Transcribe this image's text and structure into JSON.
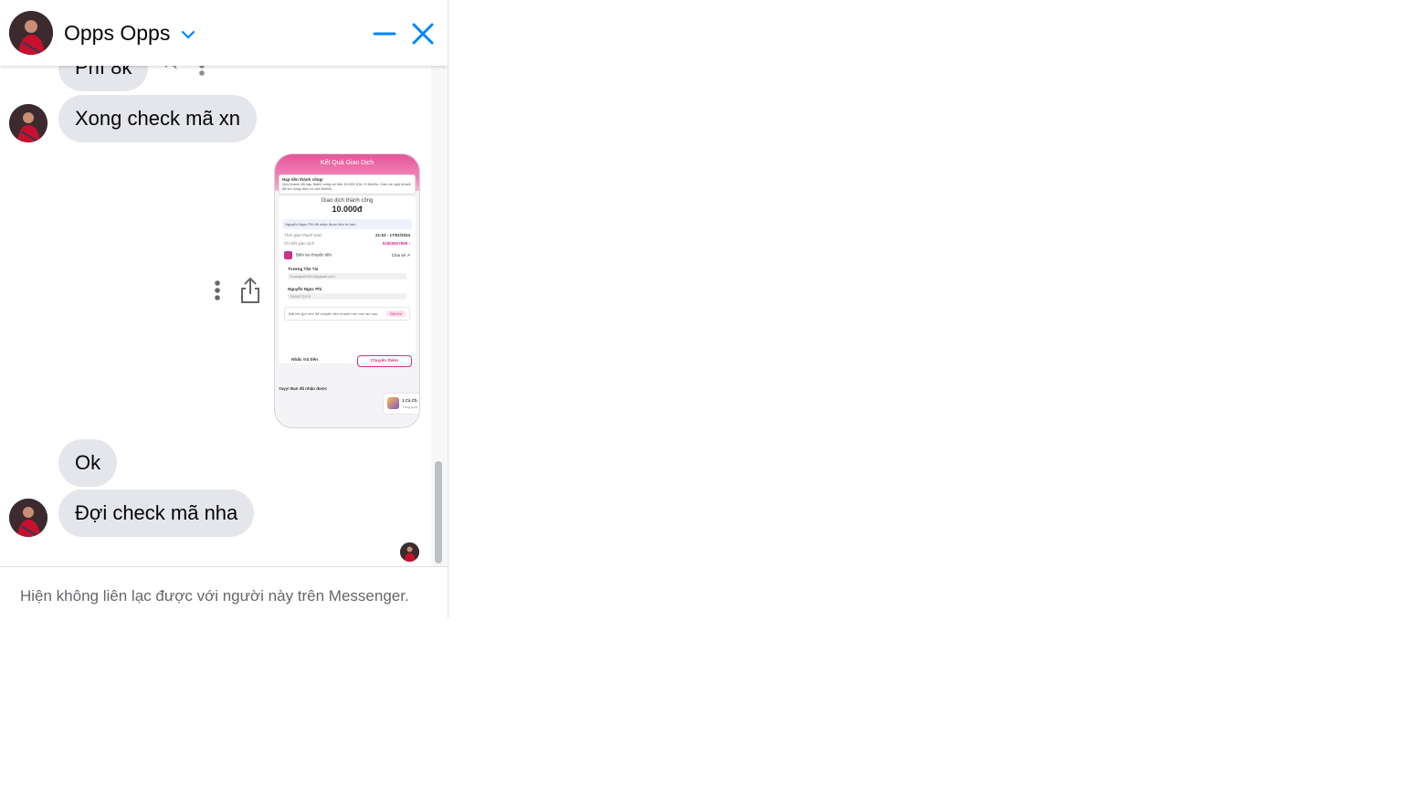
{
  "header": {
    "contact_name": "Opps Opps",
    "icons": [
      "chevron-down-icon",
      "minimize-icon",
      "close-icon"
    ],
    "accent_color": "#0084ff"
  },
  "messages": [
    {
      "id": "m1",
      "text": "Phí 8k",
      "from": "contact"
    },
    {
      "id": "m2",
      "text": "Xong check mã xn",
      "from": "contact"
    },
    {
      "id": "m3",
      "type": "image",
      "from": "contact"
    },
    {
      "id": "m4",
      "text": "Ok",
      "from": "contact"
    },
    {
      "id": "m5",
      "text": "Đợi check mã nha",
      "from": "contact"
    }
  ],
  "image_message": {
    "title": "Kết Quả Giao Dịch",
    "notice_title": "Nạp tiền thành công!",
    "notice_body": "Quý khách đã nạp thành công số tiền 10.000 đ từ Ví MoMo. Cảm ơn quý khách đã sử dụng dịch vụ của MoMo.",
    "status": "Giao dịch thành công",
    "amount": "10.000đ",
    "info": "Nguyễn Ngọc Phi đã nhận được tiền từ bạn",
    "time_label": "Thời gian thanh toán",
    "time_value": "21:53 - 17/01/2024",
    "detail_label": "Chi tiết giao dịch",
    "detail_value": "51805827695 ›",
    "receipt_label": "Biên lai chuyển tiền",
    "share_label": "Chia sẻ ⇗",
    "sender_name": "Trương Tấn Tài",
    "sender_email": "truongtai10011@gmail.com",
    "receiver_name": "Nguyễn Ngọc Phi",
    "receiver_phone": "0584272475",
    "tip_text": "Đặt tên gợi nhớ để chuyển tiền nhanh hơn vào lần sau.",
    "tip_button": "Đặt tên",
    "remind_button": "Nhắc trả tiền",
    "transfer_button": "Chuyển thêm",
    "footer_text": "Yayy! Bạn đã nhận được",
    "promo_title": "1 Cá Ch",
    "promo_sub": "Tặng quà"
  },
  "actions": {
    "icons": [
      "reply-icon",
      "more-options-icon",
      "share-icon"
    ]
  },
  "footer": {
    "notice": "Hiện không liên lạc được với người này trên Messenger."
  }
}
